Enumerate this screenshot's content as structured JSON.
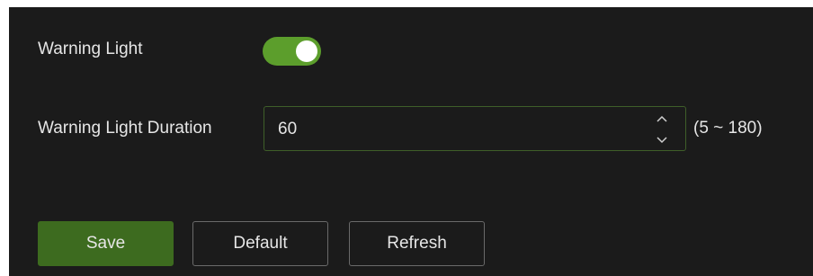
{
  "settings": {
    "warning_light": {
      "label": "Warning Light",
      "enabled": true
    },
    "warning_light_duration": {
      "label": "Warning Light Duration",
      "value": "60",
      "range_hint": "(5 ~ 180)"
    }
  },
  "actions": {
    "save_label": "Save",
    "default_label": "Default",
    "refresh_label": "Refresh"
  },
  "colors": {
    "accent": "#5c9e2c",
    "save_button": "#3d6b1f",
    "panel_background": "#1b1b1b"
  },
  "icons": {
    "spinner": "chevron-up-down-icon"
  }
}
